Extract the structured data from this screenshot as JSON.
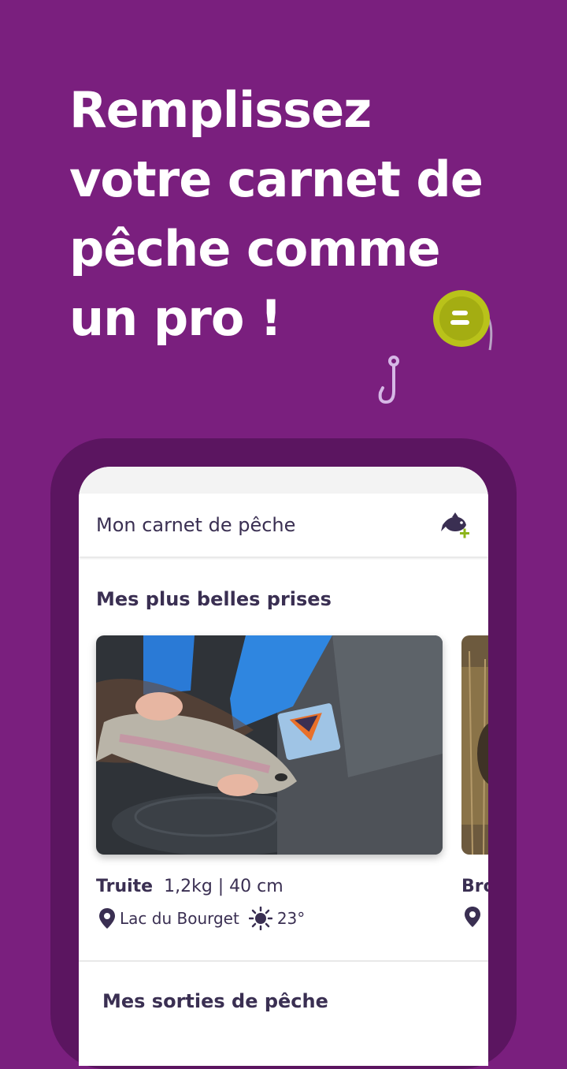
{
  "headline": {
    "lines": [
      "Remplissez",
      "votre carnet de",
      "pêche comme",
      "un pro !"
    ]
  },
  "app": {
    "title": "Mon carnet de pêche",
    "sections": {
      "best_catches": "Mes plus belles prises",
      "fishing_trips": "Mes sorties de pêche"
    },
    "catches": [
      {
        "species": "Truite",
        "details": "1,2kg | 40 cm",
        "location": "Lac du Bourget",
        "temperature": "23°",
        "weather_icon": "sun-icon"
      },
      {
        "species": "Bro"
      }
    ]
  },
  "colors": {
    "background": "#7a1f7e",
    "phone_frame": "#5b1560",
    "text_dark": "#3a2f52",
    "reel": "#b9c21a"
  }
}
